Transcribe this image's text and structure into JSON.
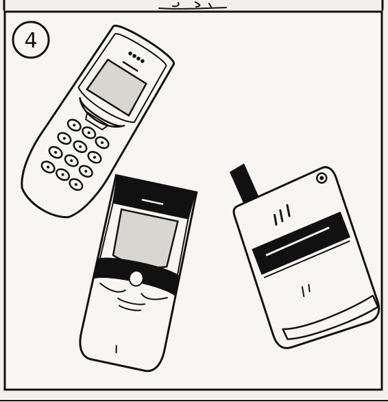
{
  "panel": {
    "number": "4"
  }
}
